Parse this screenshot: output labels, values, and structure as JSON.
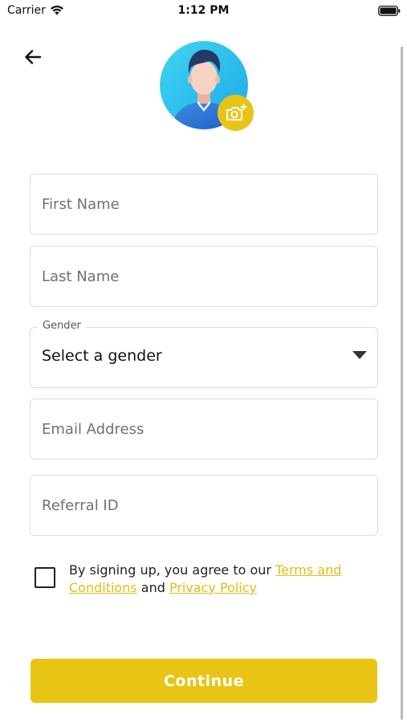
{
  "status_bar": {
    "carrier": "Carrier",
    "time": "1:12 PM"
  },
  "icons": {
    "back": "arrow-left-icon",
    "avatar": "default-user-avatar",
    "camera": "camera-plus-icon",
    "dropdown": "caret-down-icon"
  },
  "form": {
    "first_name": {
      "placeholder": "First Name",
      "value": ""
    },
    "last_name": {
      "placeholder": "Last Name",
      "value": ""
    },
    "gender": {
      "label": "Gender",
      "value": "Select a gender"
    },
    "email": {
      "placeholder": "Email Address",
      "value": ""
    },
    "referral": {
      "placeholder": "Referral ID",
      "value": ""
    }
  },
  "agreement": {
    "prefix": "By signing up, you agree to our ",
    "terms_link": "Terms and Conditions",
    "connector": " and ",
    "privacy_link": "Privacy Policy",
    "checked": false
  },
  "continue_label": "Continue",
  "colors": {
    "accent": "#e8c414",
    "avatar_bg": "#2ec5f0",
    "field_border": "#dcdcdc"
  }
}
